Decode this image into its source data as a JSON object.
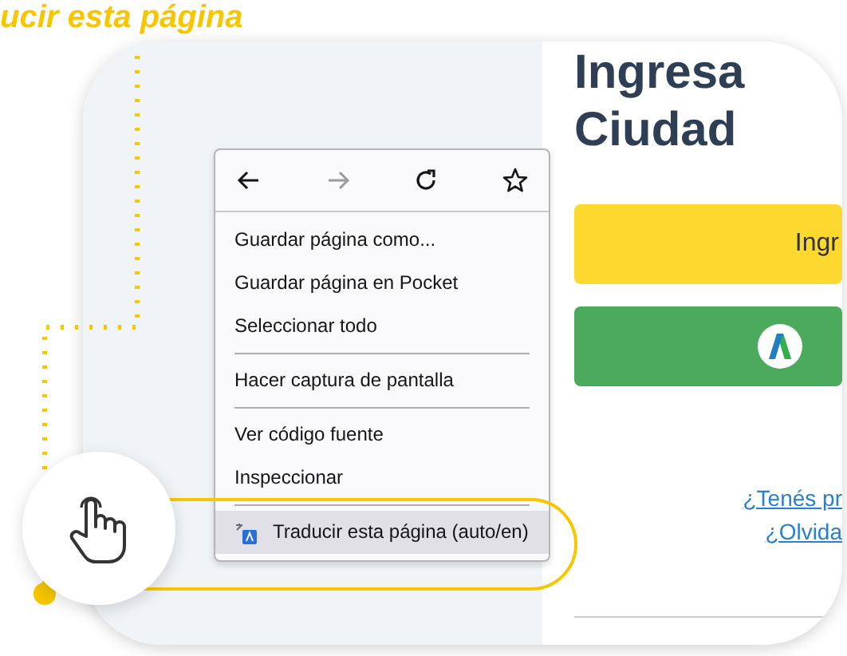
{
  "heading": "ucir esta página",
  "page": {
    "title_lines": [
      "Ingresa",
      "Ciudad"
    ],
    "buttons": [
      {
        "kind": "primary",
        "label": "Ingr"
      },
      {
        "kind": "logo"
      }
    ],
    "links": [
      "¿Tenés pr",
      "¿Olvida"
    ]
  },
  "context_menu": {
    "nav_buttons": [
      {
        "kind": "back",
        "disabled": false
      },
      {
        "kind": "forward",
        "disabled": true
      },
      {
        "kind": "reload",
        "disabled": false
      },
      {
        "kind": "bookmark",
        "disabled": false
      }
    ],
    "items": [
      {
        "kind": "text",
        "label": "Guardar página como...",
        "separator_before": false,
        "selected": false
      },
      {
        "kind": "text",
        "label": "Guardar página en Pocket",
        "separator_before": false,
        "selected": false
      },
      {
        "kind": "text",
        "label": "Seleccionar todo",
        "separator_before": false,
        "selected": false
      },
      {
        "kind": "text",
        "label": "Hacer captura de pantalla",
        "separator_before": true,
        "selected": false
      },
      {
        "kind": "text",
        "label": "Ver código fuente",
        "separator_before": true,
        "selected": false
      },
      {
        "kind": "text",
        "label": "Inspeccionar",
        "separator_before": false,
        "selected": false
      },
      {
        "kind": "translate",
        "label": "Traducir esta página (auto/en)",
        "separator_before": true,
        "selected": true
      }
    ]
  }
}
